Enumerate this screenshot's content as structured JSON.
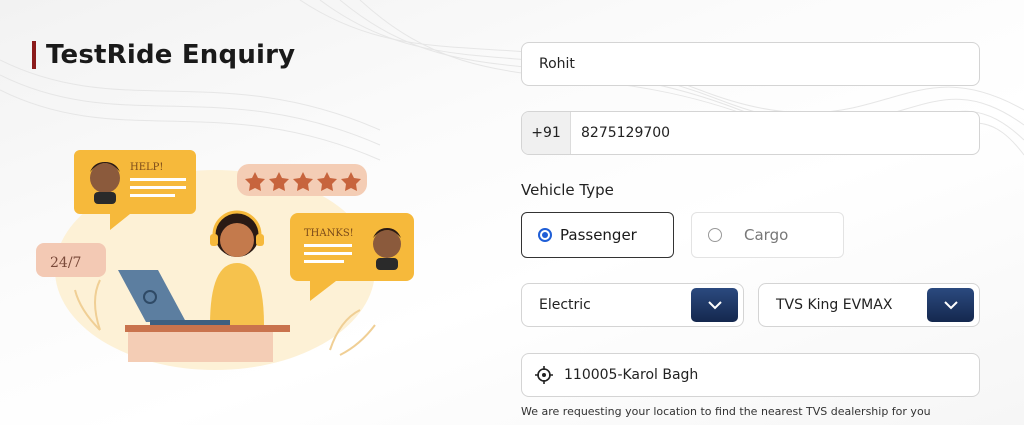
{
  "header": {
    "title": "TestRide Enquiry"
  },
  "illustration": {
    "help_text": "HELP!",
    "thanks_text": "THANKS!",
    "availability_text": "24/7",
    "rating_stars": 5
  },
  "form": {
    "name_value": "Rohit",
    "phone_prefix": "+91",
    "phone_value": "8275129700",
    "vehicle_type_label": "Vehicle Type",
    "vehicle_types": [
      {
        "label": "Passenger",
        "selected": true
      },
      {
        "label": "Cargo",
        "selected": false
      }
    ],
    "fuel_type_value": "Electric",
    "model_value": "TVS King EVMAX",
    "location_value": "110005-Karol Bagh",
    "location_note": "We are requesting your location to find the nearest TVS dealership for you"
  },
  "colors": {
    "title_accent": "#8b1a1a",
    "select_button": "#1b335f",
    "radio_selected": "#1f5ed6",
    "illustration_yellow": "#f6b93b"
  },
  "icons": {
    "dropdown": "chevron-down-icon",
    "location": "crosshair-icon"
  }
}
